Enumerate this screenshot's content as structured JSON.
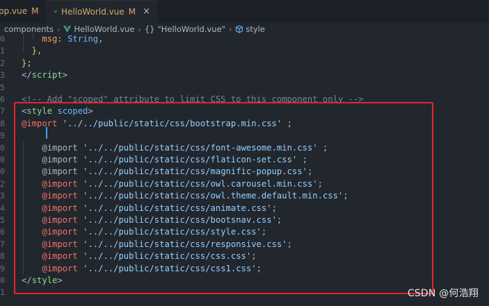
{
  "tabs": [
    {
      "label": "pp.vue",
      "modified": "M",
      "active": false
    },
    {
      "label": "HelloWorld.vue",
      "modified": "M",
      "active": true,
      "close": "×"
    }
  ],
  "breadcrumb": {
    "folder": "components",
    "file": "HelloWorld.vue",
    "braces": "{}",
    "object": "\"HelloWorld.vue\"",
    "symbol": "style"
  },
  "code_lines": [
    {
      "num": "0",
      "parts": [
        [
          "    ",
          "t-punct"
        ],
        [
          "msg",
          "t-key"
        ],
        [
          ": ",
          "t-punct"
        ],
        [
          "String",
          "t-type"
        ],
        [
          ",",
          "t-punct"
        ]
      ]
    },
    {
      "num": "1",
      "parts": [
        [
          "  },",
          "t-yellow"
        ]
      ]
    },
    {
      "num": "2",
      "parts": [
        [
          "};",
          "t-yellow"
        ]
      ]
    },
    {
      "num": "3",
      "parts": [
        [
          "</",
          "t-bracket"
        ],
        [
          "script",
          "t-tag"
        ],
        [
          ">",
          "t-bracket"
        ]
      ]
    },
    {
      "num": "5",
      "parts": [
        [
          "",
          "t-punct"
        ]
      ]
    },
    {
      "num": "6",
      "parts": [
        [
          "<!-- Add \"scoped\" attribute to limit CSS to this component only -->",
          "t-comment"
        ]
      ]
    },
    {
      "num": "7",
      "parts": [
        [
          "<",
          "t-bracket"
        ],
        [
          "style",
          "t-tag"
        ],
        [
          " ",
          "t-punct"
        ],
        [
          "scoped",
          "t-attr"
        ],
        [
          ">",
          "t-bracket"
        ]
      ]
    },
    {
      "num": "8",
      "parts": [
        [
          "@import",
          "t-at-red"
        ],
        [
          " ",
          "t-punct"
        ],
        [
          "'../../public/static/css/bootstrap.min.css'",
          "t-str"
        ],
        [
          " ;",
          "t-punct"
        ]
      ]
    },
    {
      "num": "9",
      "parts": [
        [
          "",
          "t-punct"
        ]
      ]
    },
    {
      "num": "0",
      "parts": [
        [
          "    ",
          "t-punct"
        ],
        [
          "@import",
          "t-at-plain"
        ],
        [
          " ",
          "t-punct"
        ],
        [
          "'../../public/static/css/font-awesome.min.css'",
          "t-str"
        ],
        [
          " ;",
          "t-punct"
        ]
      ]
    },
    {
      "num": "0",
      "parts": [
        [
          "    ",
          "t-punct"
        ],
        [
          "@import",
          "t-at-plain"
        ],
        [
          " ",
          "t-punct"
        ],
        [
          "'../../public/static/css/flaticon-set.css'",
          "t-str"
        ],
        [
          " ;",
          "t-punct"
        ]
      ]
    },
    {
      "num": "0",
      "parts": [
        [
          "    ",
          "t-punct"
        ],
        [
          "@import",
          "t-at-plain"
        ],
        [
          " ",
          "t-punct"
        ],
        [
          "'../../public/static/css/magnific-popup.css'",
          "t-str"
        ],
        [
          ";",
          "t-punct"
        ]
      ]
    },
    {
      "num": "2",
      "parts": [
        [
          "    ",
          "t-punct"
        ],
        [
          "@import",
          "t-at-red"
        ],
        [
          " ",
          "t-punct"
        ],
        [
          "'../../public/static/css/owl.carousel.min.css'",
          "t-str"
        ],
        [
          ";",
          "t-punct"
        ]
      ]
    },
    {
      "num": "3",
      "parts": [
        [
          "    ",
          "t-punct"
        ],
        [
          "@import",
          "t-at-red"
        ],
        [
          " ",
          "t-punct"
        ],
        [
          "'../../public/static/css/owl.theme.default.min.css'",
          "t-str"
        ],
        [
          ";",
          "t-punct"
        ]
      ]
    },
    {
      "num": "4",
      "parts": [
        [
          "    ",
          "t-punct"
        ],
        [
          "@import",
          "t-at-red"
        ],
        [
          " ",
          "t-punct"
        ],
        [
          "'../../public/static/css/animate.css'",
          "t-str"
        ],
        [
          ";",
          "t-punct"
        ]
      ]
    },
    {
      "num": "5",
      "parts": [
        [
          "    ",
          "t-punct"
        ],
        [
          "@import",
          "t-at-red"
        ],
        [
          " ",
          "t-punct"
        ],
        [
          "'../../public/static/css/bootsnav.css'",
          "t-str"
        ],
        [
          ";",
          "t-punct"
        ]
      ]
    },
    {
      "num": "6",
      "parts": [
        [
          "    ",
          "t-punct"
        ],
        [
          "@import",
          "t-at-red"
        ],
        [
          " ",
          "t-punct"
        ],
        [
          "'../../public/static/css/style.css'",
          "t-str"
        ],
        [
          ";",
          "t-punct"
        ]
      ]
    },
    {
      "num": "7",
      "parts": [
        [
          "    ",
          "t-punct"
        ],
        [
          "@import",
          "t-at-red"
        ],
        [
          " ",
          "t-punct"
        ],
        [
          "'../../public/static/css/responsive.css'",
          "t-str"
        ],
        [
          ";",
          "t-punct"
        ]
      ]
    },
    {
      "num": "8",
      "parts": [
        [
          "    ",
          "t-punct"
        ],
        [
          "@import",
          "t-at-red"
        ],
        [
          " ",
          "t-punct"
        ],
        [
          "'../../public/static/css/css.css'",
          "t-str"
        ],
        [
          ";",
          "t-punct"
        ]
      ]
    },
    {
      "num": "9",
      "parts": [
        [
          "    ",
          "t-punct"
        ],
        [
          "@import",
          "t-at-red"
        ],
        [
          " ",
          "t-punct"
        ],
        [
          "'../../public/static/css/css1.css'",
          "t-str"
        ],
        [
          ";",
          "t-punct"
        ]
      ]
    },
    {
      "num": "0",
      "parts": [
        [
          "</",
          "t-bracket"
        ],
        [
          "style",
          "t-tag"
        ],
        [
          ">",
          "t-bracket"
        ]
      ]
    },
    {
      "num": "1",
      "parts": [
        [
          "",
          "t-punct"
        ]
      ]
    }
  ],
  "watermark": "CSDN @何浩翔",
  "colors": {
    "background": "#22272e",
    "tab_modified": "#d4a86a",
    "highlight_border": "#e5262d",
    "vue_green": "#41b883"
  }
}
